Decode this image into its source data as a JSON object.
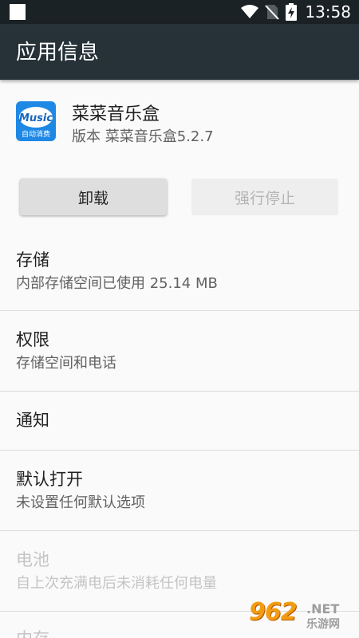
{
  "status_bar": {
    "time": "13:58",
    "icons": [
      "wifi-icon",
      "no-sim-icon",
      "battery-charging-icon"
    ]
  },
  "app_bar": {
    "title": "应用信息"
  },
  "app": {
    "icon_text": "Music",
    "icon_subtext": "自动消费",
    "name": "菜菜音乐盒",
    "version": "版本 菜菜音乐盒5.2.7"
  },
  "buttons": {
    "uninstall": "卸载",
    "force_stop": "强行停止"
  },
  "items": [
    {
      "title": "存储",
      "summary": "内部存储空间已使用 25.14 MB",
      "enabled": true
    },
    {
      "title": "权限",
      "summary": "存储空间和电话",
      "enabled": true
    },
    {
      "title": "通知",
      "summary": "",
      "enabled": true
    },
    {
      "title": "默认打开",
      "summary": "未设置任何默认选项",
      "enabled": true
    },
    {
      "title": "电池",
      "summary": "自上次充满电后未消耗任何电量",
      "enabled": false
    },
    {
      "title": "内存",
      "summary": "",
      "enabled": false
    }
  ],
  "watermark": {
    "logo": "962",
    "suffix": ".NET",
    "site": "乐游网"
  },
  "colors": {
    "app_bar": "#263238",
    "status_bar": "#1b2226",
    "background": "#fafafa",
    "icon_blue": "#2196f3"
  }
}
